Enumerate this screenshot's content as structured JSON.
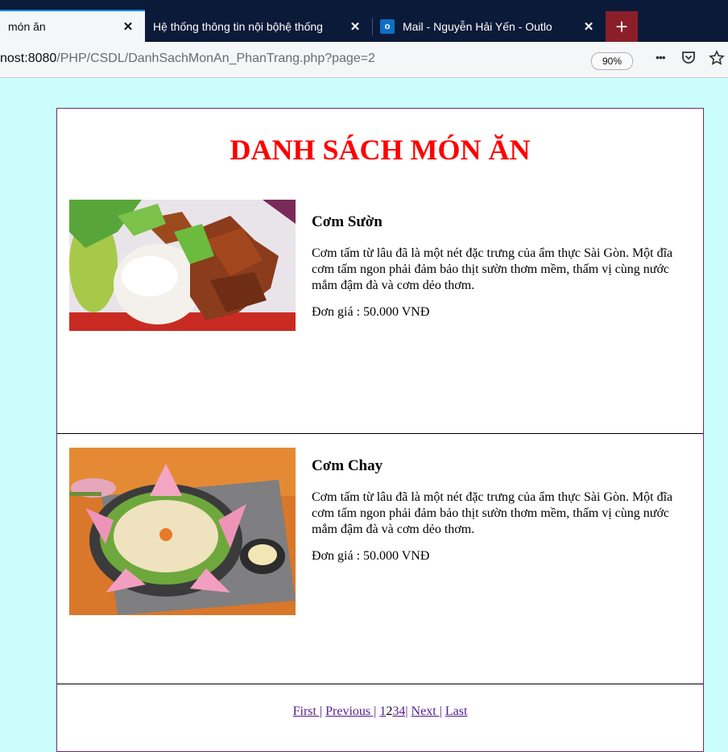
{
  "browser": {
    "tabs": [
      {
        "title": "món ăn",
        "active": true
      },
      {
        "title": "Hệ thống thông tin nội bộhệ thống",
        "active": false
      },
      {
        "title": "Mail - Nguyễn Hải Yến - Outlo",
        "active": false
      }
    ],
    "close_glyph": "✕",
    "new_tab_glyph": "+",
    "outlook_icon_letter": "o",
    "url_host": "nost:8080",
    "url_path": "/PHP/CSDL/DanhSachMonAn_PhanTrang.php?page=2",
    "zoom": "90%",
    "menu_glyph": "•••"
  },
  "page": {
    "title": "DANH SÁCH MÓN ĂN",
    "items": [
      {
        "name": "Cơm Sườn",
        "description": "Cơm tấm từ lâu đã là một nét đặc trưng của ẩm thực Sài Gòn. Một đĩa cơm tấm ngon phải đảm bảo thịt sườn thơm mềm, thấm vị cùng nước mắm đậm đà và cơm dẻo thơm.",
        "price": "Đơn giá : 50.000 VNĐ"
      },
      {
        "name": "Cơm Chay",
        "description": "Cơm tấm từ lâu đã là một nét đặc trưng của ẩm thực Sài Gòn. Một đĩa cơm tấm ngon phải đảm bảo thịt sườn thơm mềm, thấm vị cùng nước mắm đậm đà và cơm dẻo thơm.",
        "price": "Đơn giá : 50.000 VNĐ"
      }
    ],
    "pagination": {
      "first": "First |",
      "previous": "Previous |",
      "page1": "1",
      "page2": "2",
      "page3": "3",
      "page4": "4|",
      "next": "Next |",
      "last": "Last"
    }
  },
  "colors": {
    "page_background": "#ccfdfd",
    "title": "#ff0000",
    "link": "#551a8b",
    "border": "#6d2d6d"
  }
}
